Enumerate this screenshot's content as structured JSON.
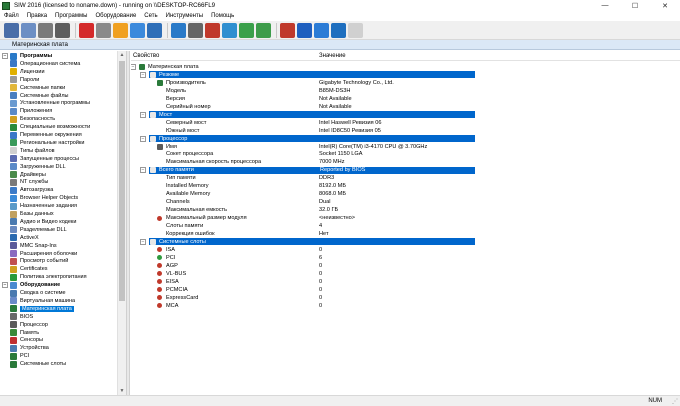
{
  "window": {
    "title": "SIW 2016 (licensed to noname.down) - running on \\\\DESKTOP-RC66FL9",
    "minimize": "—",
    "maximize": "☐",
    "close": "✕"
  },
  "menu": [
    "Файл",
    "Правка",
    "Программы",
    "Оборудование",
    "Сеть",
    "Инструменты",
    "Помощь"
  ],
  "toolbar": {
    "buttons": [
      {
        "name": "save-icon",
        "color": "#4a6ea8"
      },
      {
        "name": "report-icon",
        "color": "#6d8fc4"
      },
      {
        "name": "html-icon",
        "color": "#7a7a7a"
      },
      {
        "name": "print-icon",
        "color": "#5e5e5e"
      },
      {
        "name": "stop-icon",
        "color": "#d42a2a"
      },
      {
        "name": "key-icon",
        "color": "#8a8a8a"
      },
      {
        "name": "wizard-icon",
        "color": "#f0a020"
      },
      {
        "name": "search-icon",
        "color": "#3c8adc"
      },
      {
        "name": "network-icon",
        "color": "#2f6fb8"
      },
      {
        "name": "refresh-icon",
        "color": "#2a7ac8"
      },
      {
        "name": "gear-icon",
        "color": "#666666"
      },
      {
        "name": "tools-icon",
        "color": "#c0392b"
      },
      {
        "name": "monitor-icon",
        "color": "#2f8fd0"
      },
      {
        "name": "chart-icon",
        "color": "#3aa04a"
      },
      {
        "name": "cable-icon",
        "color": "#3d9c4a"
      },
      {
        "name": "weather-icon",
        "color": "#c0392b"
      },
      {
        "name": "help-icon",
        "color": "#1f5fbf"
      },
      {
        "name": "bulb-icon",
        "color": "#2c7cd6"
      },
      {
        "name": "chat-icon",
        "color": "#1f6fbf"
      },
      {
        "name": "email-icon",
        "color": "#d0d0d0"
      }
    ]
  },
  "page_header": "Материнская плата",
  "sidebar": {
    "items": [
      {
        "label": "Программы",
        "level": 0,
        "group": true,
        "expanded": true,
        "color": "#2a7ac8"
      },
      {
        "label": "Операционная система",
        "level": 1,
        "color": "#3b78c5"
      },
      {
        "label": "Лицензии",
        "level": 1,
        "color": "#e0b000"
      },
      {
        "label": "Пароли",
        "level": 1,
        "color": "#9a9a9a"
      },
      {
        "label": "Системные папки",
        "level": 1,
        "color": "#e2b73a"
      },
      {
        "label": "Системные файлы",
        "level": 1,
        "color": "#4a7fc0"
      },
      {
        "label": "Установленные программы",
        "level": 1,
        "color": "#6a9ad0"
      },
      {
        "label": "Приложения",
        "level": 1,
        "color": "#5a8ac8"
      },
      {
        "label": "Безопасность",
        "level": 1,
        "color": "#d1a020"
      },
      {
        "label": "Специальные возможности",
        "level": 1,
        "color": "#2a8a3a"
      },
      {
        "label": "Переменные окружения",
        "level": 1,
        "color": "#3a78c8"
      },
      {
        "label": "Региональные настройки",
        "level": 1,
        "color": "#3a9a5a"
      },
      {
        "label": "Типы файлов",
        "level": 1,
        "color": "#d0d0d0"
      },
      {
        "label": "Запущенные процессы",
        "level": 1,
        "color": "#5a6ab0"
      },
      {
        "label": "Загруженные DLL",
        "level": 1,
        "color": "#5a8ac8"
      },
      {
        "label": "Драйверы",
        "level": 1,
        "color": "#4a8a4a"
      },
      {
        "label": "NT службы",
        "level": 1,
        "color": "#7a7a7a"
      },
      {
        "label": "Автозагрузка",
        "level": 1,
        "color": "#3a7ac8"
      },
      {
        "label": "Browser Helper Objects",
        "level": 1,
        "color": "#3a8ad8"
      },
      {
        "label": "Назначенные задания",
        "level": 1,
        "color": "#5a9ac8"
      },
      {
        "label": "Базы данных",
        "level": 1,
        "color": "#c0a060"
      },
      {
        "label": "Аудио и Видео кодеки",
        "level": 1,
        "color": "#4a7ab0"
      },
      {
        "label": "Разделяемые DLL",
        "level": 1,
        "color": "#6a8ac0"
      },
      {
        "label": "ActiveX",
        "level": 1,
        "color": "#2a6ab0"
      },
      {
        "label": "MMC Snap-Ins",
        "level": 1,
        "color": "#5a5a9a"
      },
      {
        "label": "Расширения оболочки",
        "level": 1,
        "color": "#8a6ac0"
      },
      {
        "label": "Просмотр событий",
        "level": 1,
        "color": "#c05050"
      },
      {
        "label": "Certificates",
        "level": 1,
        "color": "#d0a020"
      },
      {
        "label": "Политика электропитания",
        "level": 1,
        "color": "#2a9a3a"
      },
      {
        "label": "Оборудование",
        "level": 0,
        "group": true,
        "expanded": true,
        "color": "#4a8ad0"
      },
      {
        "label": "Сводка о системе",
        "level": 1,
        "color": "#4a7ab0"
      },
      {
        "label": "Виртуальная машина",
        "level": 1,
        "color": "#6a8ac8"
      },
      {
        "label": "Материнская плата",
        "level": 1,
        "selected": true,
        "color": "#2a7a3a"
      },
      {
        "label": "BIOS",
        "level": 1,
        "color": "#6a6a6a"
      },
      {
        "label": "Процессор",
        "level": 1,
        "color": "#5a5a5a"
      },
      {
        "label": "Память",
        "level": 1,
        "color": "#3a8a3a"
      },
      {
        "label": "Сенсоры",
        "level": 1,
        "color": "#c03030"
      },
      {
        "label": "Устройства",
        "level": 1,
        "color": "#4a7ab0"
      },
      {
        "label": "PCI",
        "level": 1,
        "color": "#2a7a3a"
      },
      {
        "label": "Системные слоты",
        "level": 1,
        "color": "#2a7a3a"
      }
    ]
  },
  "main": {
    "col_property": "Свойство",
    "col_value": "Значение",
    "rows": [
      {
        "type": "root",
        "key": "Материнская плата",
        "value": ""
      },
      {
        "type": "section",
        "key": "Резюме",
        "value": ""
      },
      {
        "type": "item",
        "key": "Производитель",
        "value": "Gigabyte Technology Co., Ltd.",
        "icon": "#2a7a3a"
      },
      {
        "type": "item",
        "key": "Модель",
        "value": "B85M-DS3H",
        "icon": "none"
      },
      {
        "type": "item",
        "key": "Версия",
        "value": "Not Available",
        "icon": "none"
      },
      {
        "type": "item",
        "key": "Серийный номер",
        "value": "Not Available",
        "icon": "none"
      },
      {
        "type": "section",
        "key": "Мост",
        "value": ""
      },
      {
        "type": "item",
        "key": "Северный мост",
        "value": "Intel Haswell Ревизия 06",
        "icon": "none"
      },
      {
        "type": "item",
        "key": "Южный мост",
        "value": "Intel ID8C50 Ревизия 05",
        "icon": "none"
      },
      {
        "type": "section",
        "key": "Процессор",
        "value": ""
      },
      {
        "type": "item",
        "key": "Имя",
        "value": "Intel(R) Core(TM) i3-4170 CPU @ 3.70GHz",
        "icon": "#5a5a5a"
      },
      {
        "type": "item",
        "key": "Сокет процессора",
        "value": "Socket 1150 LGA",
        "icon": "none"
      },
      {
        "type": "item",
        "key": "Максимальная скорость процессора",
        "value": "7000 MHz",
        "icon": "none"
      },
      {
        "type": "section",
        "key": "Всего памяти",
        "value": "Reported by BIOS"
      },
      {
        "type": "item",
        "key": "Тип памяти",
        "value": "DDR3",
        "icon": "none"
      },
      {
        "type": "item",
        "key": "Installed Memory",
        "value": "8192.0 МБ",
        "icon": "none"
      },
      {
        "type": "item",
        "key": "Available Memory",
        "value": "8068.0 МБ",
        "icon": "none"
      },
      {
        "type": "item",
        "key": "Channels",
        "value": "Dual",
        "icon": "none"
      },
      {
        "type": "item",
        "key": "Максимальная емкость",
        "value": "32.0 ГБ",
        "icon": "none"
      },
      {
        "type": "item",
        "key": "Максимальный размер модуля",
        "value": "<неизвестно>",
        "icon": "red-dot"
      },
      {
        "type": "item",
        "key": "Слоты памяти",
        "value": "4",
        "icon": "none"
      },
      {
        "type": "item",
        "key": "Коррекция ошибок",
        "value": "Нет",
        "icon": "none"
      },
      {
        "type": "section",
        "key": "Системные слоты",
        "value": ""
      },
      {
        "type": "item",
        "key": "ISA",
        "value": "0",
        "icon": "red-dot"
      },
      {
        "type": "item",
        "key": "PCI",
        "value": "6",
        "icon": "green-dot"
      },
      {
        "type": "item",
        "key": "AGP",
        "value": "0",
        "icon": "red-dot"
      },
      {
        "type": "item",
        "key": "VL-BUS",
        "value": "0",
        "icon": "red-dot"
      },
      {
        "type": "item",
        "key": "EISA",
        "value": "0",
        "icon": "red-dot"
      },
      {
        "type": "item",
        "key": "PCMCIA",
        "value": "0",
        "icon": "red-dot"
      },
      {
        "type": "item",
        "key": "ExpressCard",
        "value": "0",
        "icon": "red-dot"
      },
      {
        "type": "item",
        "key": "MCA",
        "value": "0",
        "icon": "red-dot"
      }
    ]
  },
  "status": {
    "num": "NUM"
  },
  "colors": {
    "section_bg": "#0066cc",
    "selected_bg": "#0078d7",
    "header_bg": "#dbe8f6",
    "red_dot": "#c0392b",
    "green_dot": "#2e9a3e"
  }
}
